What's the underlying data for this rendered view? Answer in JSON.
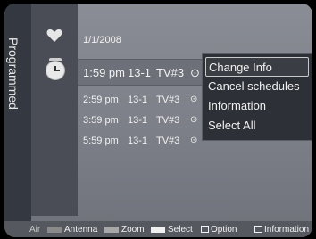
{
  "side_tab": {
    "label": "Programmed"
  },
  "schedule": {
    "date": "1/1/2008",
    "rows": [
      {
        "time": "1:59 pm",
        "channel": "13-1",
        "tv": "TV#3",
        "clock": "⊙",
        "program": ""
      },
      {
        "time": "2:59 pm",
        "channel": "13-1",
        "tv": "TV#3",
        "clock": "⊙",
        "program": ""
      },
      {
        "time": "3:59 pm",
        "channel": "13-1",
        "tv": "TV#3",
        "clock": "⊙",
        "program": ""
      },
      {
        "time": "5:59 pm",
        "channel": "13-1",
        "tv": "TV#3",
        "clock": "⊙",
        "program": ""
      }
    ]
  },
  "context_menu": {
    "items": [
      "Change Info",
      "Cancel schedules",
      "Information",
      "Select All"
    ],
    "selected_index": 0
  },
  "footer": {
    "air": "Air",
    "antenna": "Antenna",
    "zoom": "Zoom",
    "select": "Select",
    "option": "Option",
    "information": "Information",
    "colors": {
      "antenna": "#8a8a8a",
      "zoom": "#a8a8a8",
      "select": "#f0f0f0"
    }
  },
  "icons": {
    "favorite": "heart-icon",
    "timer": "clock-icon"
  }
}
